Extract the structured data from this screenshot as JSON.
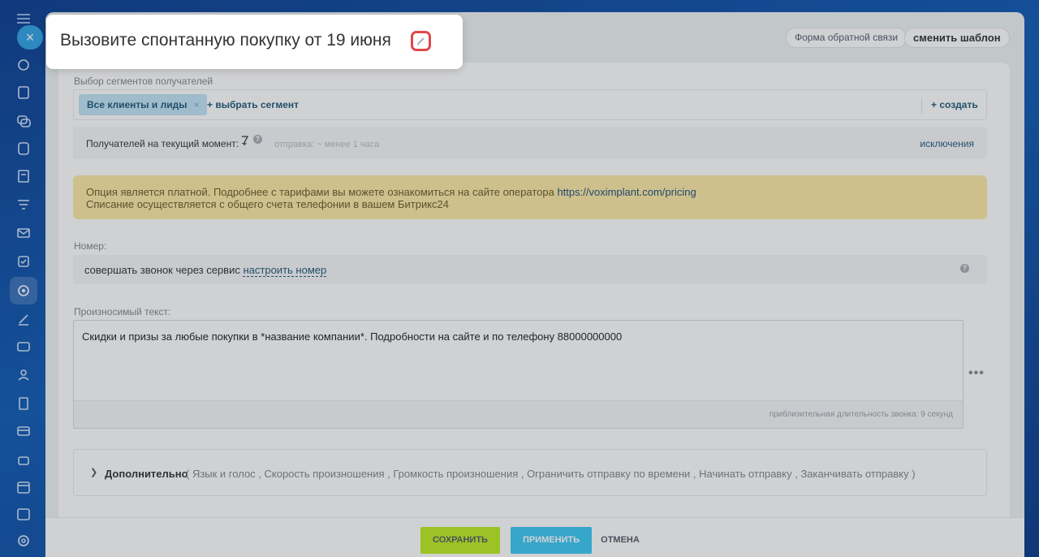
{
  "header": {
    "title": "Вызовите спонтанную покупку от 19 июня",
    "feedback_button": "Форма обратной связи",
    "change_template_button": "сменить шаблон"
  },
  "segments": {
    "label": "Выбор сегментов получателей",
    "selected_chip": "Все клиенты и лиды",
    "chip_remove": "×",
    "add_segment": "+ выбрать сегмент",
    "create": "+ создать"
  },
  "recipients": {
    "label": "Получателей на текущий момент: ~",
    "count": "7",
    "help": "?",
    "sending": "отправка: ~ менее 1 часа",
    "exceptions": "исключения"
  },
  "notice": {
    "line1": "Опция является платной. Подробнее с тарифами вы можете ознакомиться на сайте оператора",
    "link": "https://voximplant.com/pricing",
    "line2": "Списание осуществляется с общего счета телефонии в вашем Битрикс24"
  },
  "number": {
    "label": "Номер:",
    "text": "совершать звонок через сервис",
    "link": "настроить номер",
    "help": "?"
  },
  "speech": {
    "label": "Произносимый текст:",
    "value": "Скидки и призы за любые покупки в *название компании*. Подробности на сайте и по телефону 88000000000",
    "duration": "приблизительная длительность звонка: 9 секунд",
    "more": "•••"
  },
  "additional": {
    "title": "Дополнительно",
    "options": "( Язык и голос , Скорость произношения , Громкость произношения , Ограничить отправку по времени , Начинать отправку , Заканчивать отправку )"
  },
  "footer": {
    "save": "СОХРАНИТЬ",
    "apply": "ПРИМЕНИТЬ",
    "cancel": "ОТМЕНА"
  },
  "sidebar": {
    "close": "×",
    "icons": [
      "sync-icon",
      "tasks-icon",
      "chat-icon",
      "drive-icon",
      "docs-icon",
      "filter-icon",
      "mail-icon",
      "checkbox-icon",
      "marketing-icon",
      "edit-icon",
      "contact-card-icon",
      "users-icon",
      "document-icon",
      "card-icon",
      "robot-icon",
      "calendar-icon",
      "calendar2-icon",
      "settings-icon"
    ]
  },
  "colors": {
    "save": "#bbed21",
    "apply": "#3bc8f5",
    "notice": "#fbe9a6",
    "highlight": "#e2474b"
  }
}
